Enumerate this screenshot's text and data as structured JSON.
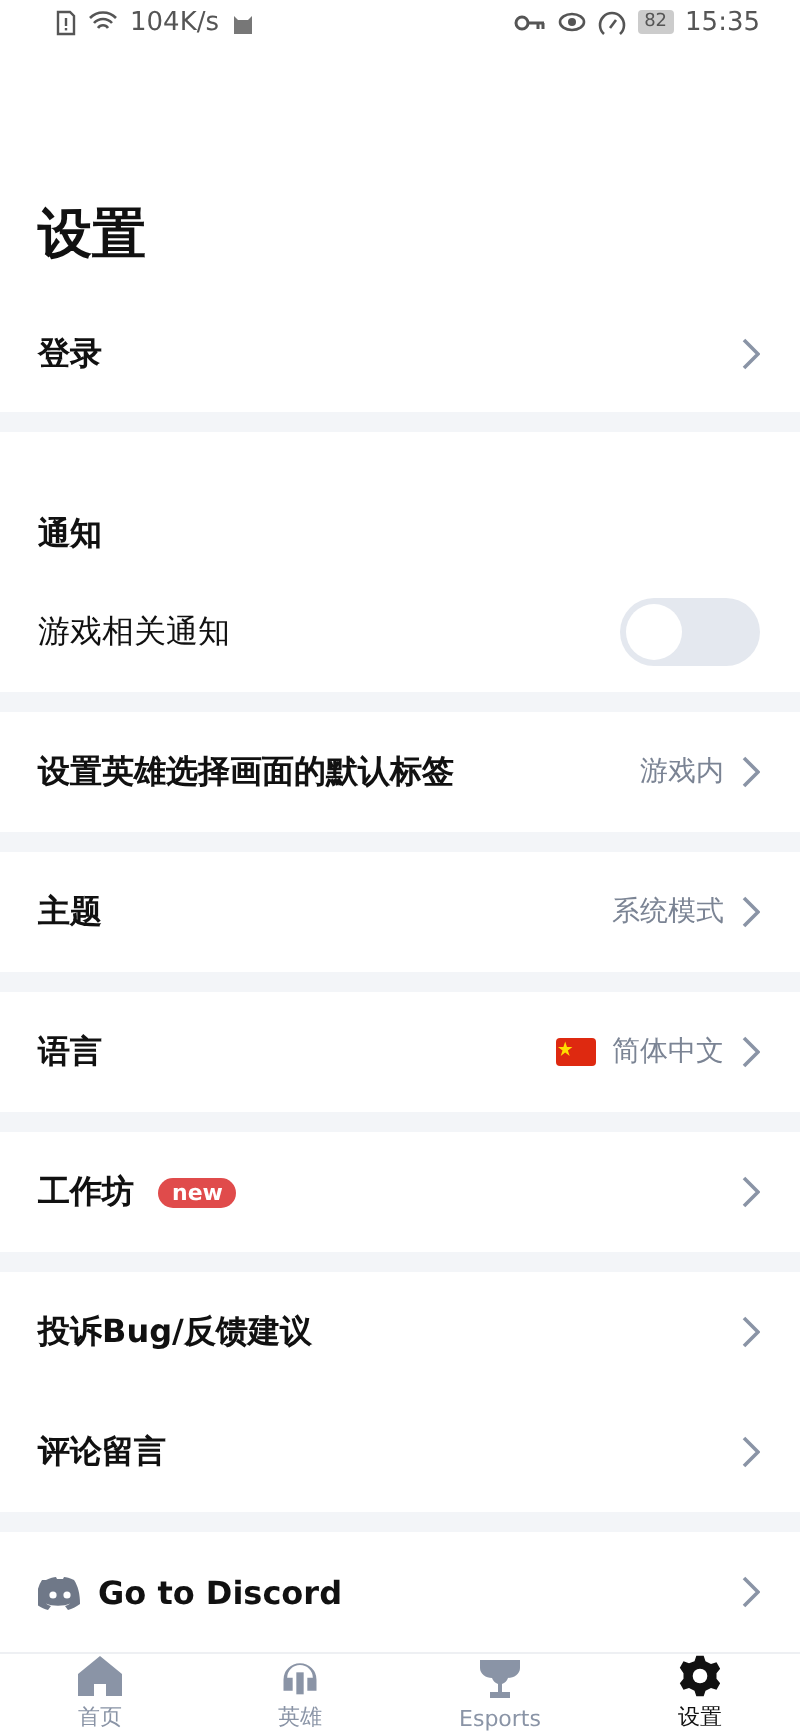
{
  "status_bar": {
    "speed": "104K/s",
    "battery": "82",
    "time": "15:35"
  },
  "title": "设置",
  "sections": [
    {
      "rows": [
        {
          "kind": "link",
          "label": "登录"
        }
      ]
    },
    {
      "rows": [
        {
          "kind": "header",
          "label": "通知"
        },
        {
          "kind": "toggle",
          "label": "游戏相关通知",
          "on": false
        }
      ]
    },
    {
      "rows": [
        {
          "kind": "link",
          "label": "设置英雄选择画面的默认标签",
          "value": "游戏内"
        }
      ]
    },
    {
      "rows": [
        {
          "kind": "link",
          "label": "主题",
          "value": "系统模式"
        }
      ]
    },
    {
      "rows": [
        {
          "kind": "link",
          "label": "语言",
          "value": "简体中文",
          "flag": true
        }
      ]
    },
    {
      "rows": [
        {
          "kind": "link",
          "label": "工作坊",
          "badge": "new"
        }
      ]
    },
    {
      "rows": [
        {
          "kind": "link",
          "label": "投诉Bug/反馈建议"
        },
        {
          "kind": "link",
          "label": "评论留言"
        }
      ]
    },
    {
      "rows": [
        {
          "kind": "link",
          "label": "Go to Discord",
          "discord": true
        }
      ]
    }
  ],
  "nav": [
    {
      "label": "首页",
      "kind": "home",
      "selected": false
    },
    {
      "label": "英雄",
      "kind": "hero",
      "selected": false
    },
    {
      "label": "Esports",
      "kind": "trophy",
      "selected": false
    },
    {
      "label": "设置",
      "kind": "gear",
      "selected": true
    }
  ]
}
